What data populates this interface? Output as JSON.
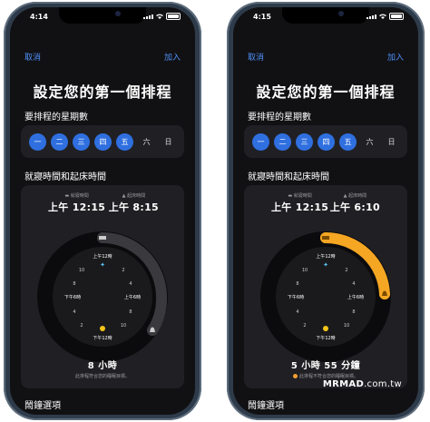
{
  "phones": [
    {
      "status_time": "4:14",
      "cancel_label": "取消",
      "add_label": "加入",
      "page_title": "設定您的第一個排程",
      "days_heading": "要排程的星期數",
      "days": [
        {
          "label": "一",
          "selected": true
        },
        {
          "label": "二",
          "selected": true
        },
        {
          "label": "三",
          "selected": true
        },
        {
          "label": "四",
          "selected": true
        },
        {
          "label": "五",
          "selected": true
        },
        {
          "label": "六",
          "selected": false
        },
        {
          "label": "日",
          "selected": false
        }
      ],
      "times_heading": "就寢時間和起床時間",
      "bedtime_label": "就寢時間",
      "bedtime_value": "上午 12:15",
      "wake_label": "起床時間",
      "wake_value": "上午 8:15",
      "dial_labels": {
        "top": "上午12時",
        "right": "上午6時",
        "bottom": "下午12時",
        "left": "下午6時"
      },
      "duration": "8 小時",
      "note": "此排程符合您的睡眠目標。",
      "note_warning": false,
      "alarm_heading": "鬧鐘選項",
      "arc_color": "#3a3a3e",
      "bed_handle_icon": "bed-icon",
      "wake_handle_icon": "bell-icon"
    },
    {
      "status_time": "4:15",
      "cancel_label": "取消",
      "add_label": "加入",
      "page_title": "設定您的第一個排程",
      "days_heading": "要排程的星期數",
      "days": [
        {
          "label": "一",
          "selected": true
        },
        {
          "label": "二",
          "selected": true
        },
        {
          "label": "三",
          "selected": true
        },
        {
          "label": "四",
          "selected": true
        },
        {
          "label": "五",
          "selected": true
        },
        {
          "label": "六",
          "selected": false
        },
        {
          "label": "日",
          "selected": false
        }
      ],
      "times_heading": "就寢時間和起床時間",
      "bedtime_label": "就寢時間",
      "bedtime_value": "上午 12:15",
      "wake_label": "起床時間",
      "wake_value": "上午 6:10",
      "dial_labels": {
        "top": "上午12時",
        "right": "上午6時",
        "bottom": "下午12時",
        "left": "下午6時"
      },
      "duration": "5 小時 55 分鐘",
      "note": "此排程不符合您的睡眠目標。",
      "note_warning": true,
      "alarm_heading": "鬧鐘選項",
      "arc_color": "#f5a623",
      "bed_handle_icon": "bed-icon",
      "wake_handle_icon": "bell-icon"
    }
  ],
  "watermark": {
    "bold": "MRMAD",
    "light": ".com.tw"
  },
  "colors": {
    "accent_blue": "#2f6fe0",
    "link_blue": "#4f8ff7",
    "sleep_arc_orange": "#f5a623",
    "card_bg": "#202024"
  }
}
